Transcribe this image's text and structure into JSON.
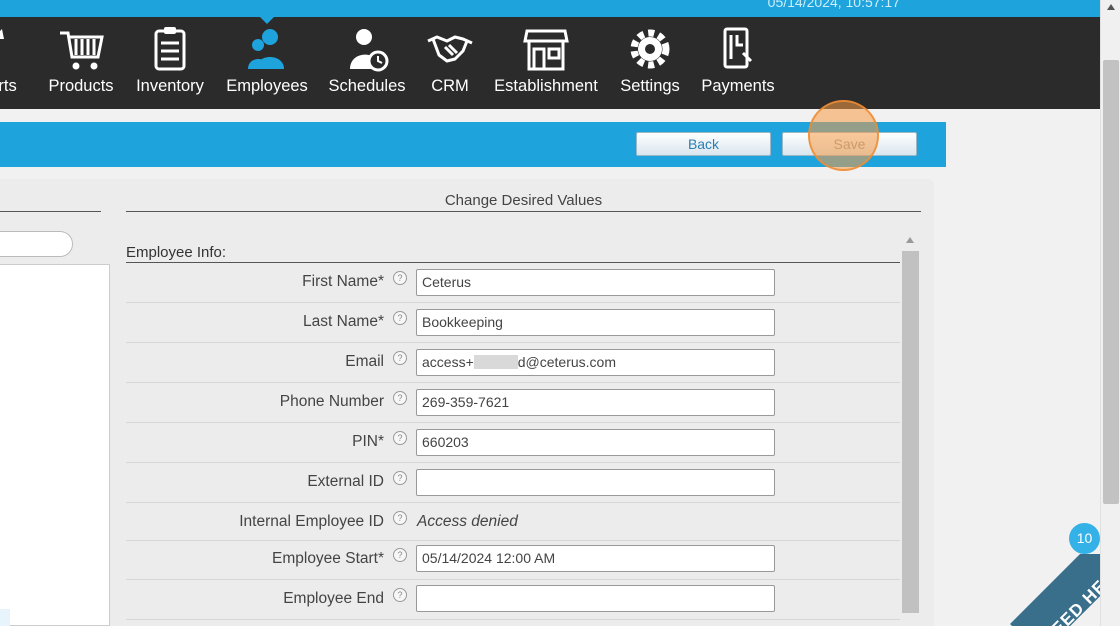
{
  "topbar": {
    "datetime": "05/14/2024, 10:57:17"
  },
  "nav": {
    "items": [
      {
        "label": "orts",
        "icon": "reports-chart-icon"
      },
      {
        "label": "Products",
        "icon": "shopping-cart-icon"
      },
      {
        "label": "Inventory",
        "icon": "clipboard-icon"
      },
      {
        "label": "Employees",
        "icon": "employees-icon",
        "active": true
      },
      {
        "label": "Schedules",
        "icon": "user-clock-icon"
      },
      {
        "label": "CRM",
        "icon": "handshake-icon"
      },
      {
        "label": "Establishment",
        "icon": "storefront-icon"
      },
      {
        "label": "Settings",
        "icon": "gear-icon"
      },
      {
        "label": "Payments",
        "icon": "payment-card-icon"
      }
    ]
  },
  "toolbar": {
    "back_label": "Back",
    "save_label": "Save"
  },
  "form": {
    "header": "Change Desired Values",
    "section_title": "Employee Info:",
    "fields": [
      {
        "label": "First Name*",
        "value": "Ceterus",
        "type": "input"
      },
      {
        "label": "Last Name*",
        "value": "Bookkeeping",
        "type": "input"
      },
      {
        "label": "Email",
        "value_prefix": "access+",
        "value_suffix": "d@ceterus.com",
        "type": "input-redacted"
      },
      {
        "label": "Phone Number",
        "value": "269-359-7621",
        "type": "input"
      },
      {
        "label": "PIN*",
        "value": "660203",
        "type": "input"
      },
      {
        "label": "External ID",
        "value": "",
        "type": "input"
      },
      {
        "label": "Internal Employee ID",
        "value": "Access denied",
        "type": "text"
      },
      {
        "label": "Employee Start*",
        "value": "05/14/2024 12:00 AM",
        "type": "input"
      },
      {
        "label": "Employee End",
        "value": "",
        "type": "input"
      }
    ],
    "help_glyph": "?"
  },
  "help_widget": {
    "badge_count": "10",
    "label": "NEED HELP"
  },
  "colors": {
    "accent": "#1ea3dc",
    "nav_bg": "#2b2b2b",
    "help_tab": "#3a6f8c"
  }
}
